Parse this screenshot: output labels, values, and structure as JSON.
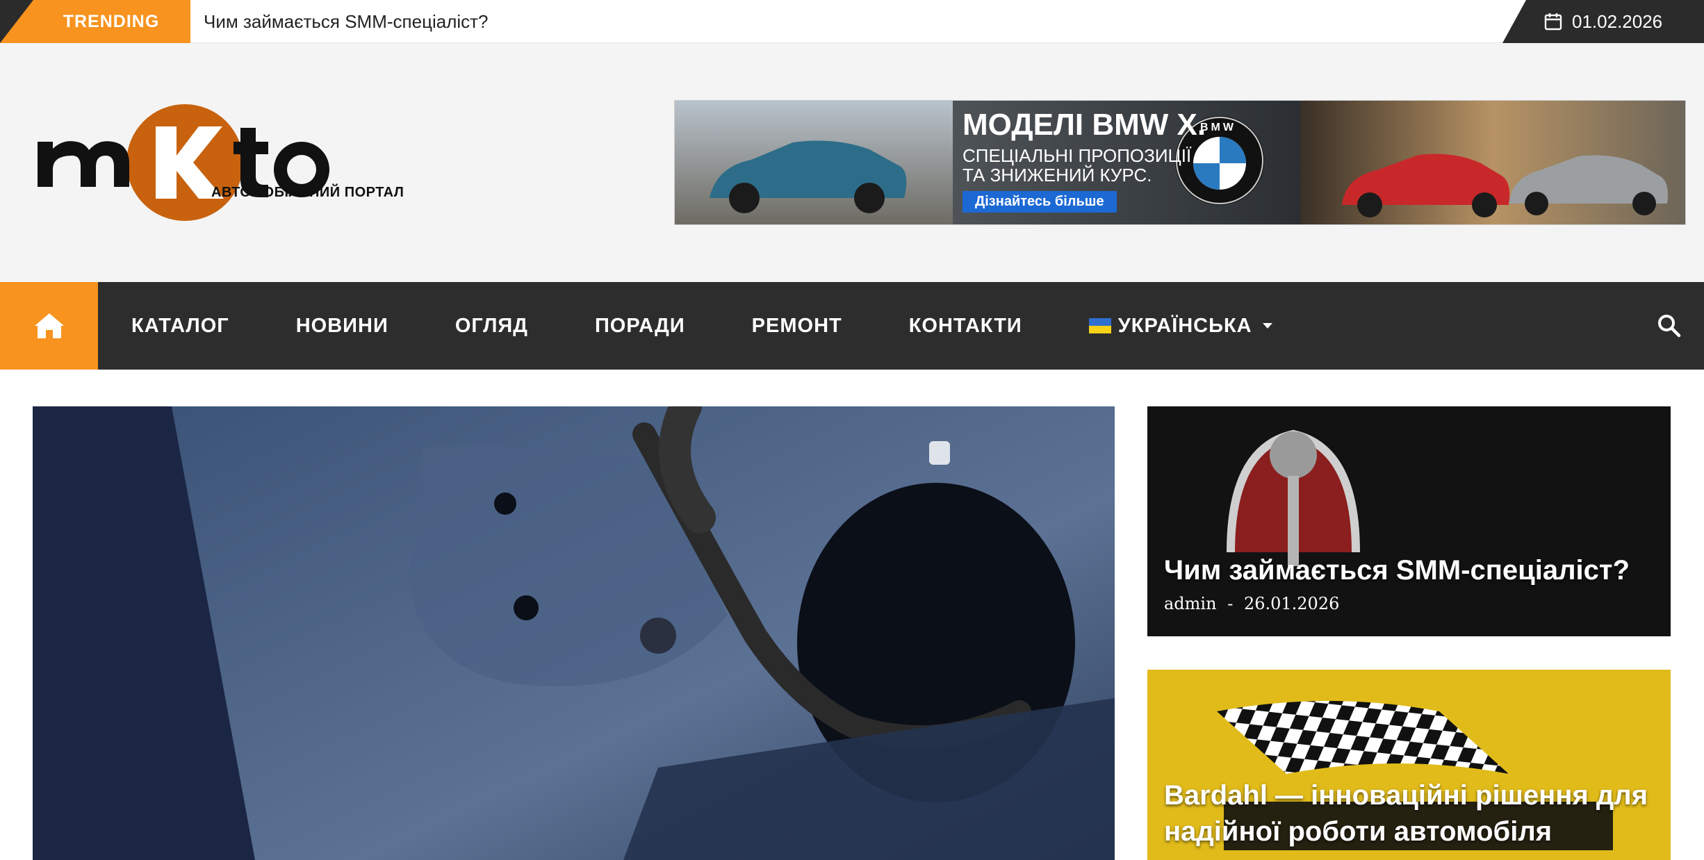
{
  "topbar": {
    "trending_label": "TRENDING",
    "trending_text": "Чим займається SMM-спеціаліст?",
    "date": "01.02.2026",
    "date_icon": "calendar-icon"
  },
  "header": {
    "logo_text": "mKto",
    "logo_subtitle": "АВТОМОБІЛЬНИЙ ПОРТАЛ",
    "banner": {
      "title": "МОДЕЛІ BMW X.",
      "subtitle_line1": "СПЕЦІАЛЬНІ ПРОПОЗИЦІЇ",
      "subtitle_line2": "ТА ЗНИЖЕНИЙ КУРС.",
      "cta": "Дізнайтесь більше",
      "brand": "BMW"
    }
  },
  "nav": {
    "home_icon": "home-icon",
    "items": [
      "КАТАЛОГ",
      "НОВИНИ",
      "ОГЛЯД",
      "ПОРАДИ",
      "РЕМОНТ",
      "КОНТАКТИ"
    ],
    "language": "УКРАЇНСЬКА",
    "search_icon": "search-icon"
  },
  "cards": [
    {
      "title": "Чим займається SMM-спеціаліст?",
      "author": "admin",
      "separator": "-",
      "date": "26.01.2026"
    },
    {
      "title_line1": "Bardahl — інноваційні рішення для",
      "title_line2": "надійної роботи автомобіля"
    }
  ],
  "colors": {
    "accent": "#f7931e",
    "dark": "#2d2d2d",
    "header_bg": "#f4f4f4",
    "logo_orange": "#c8620e"
  }
}
